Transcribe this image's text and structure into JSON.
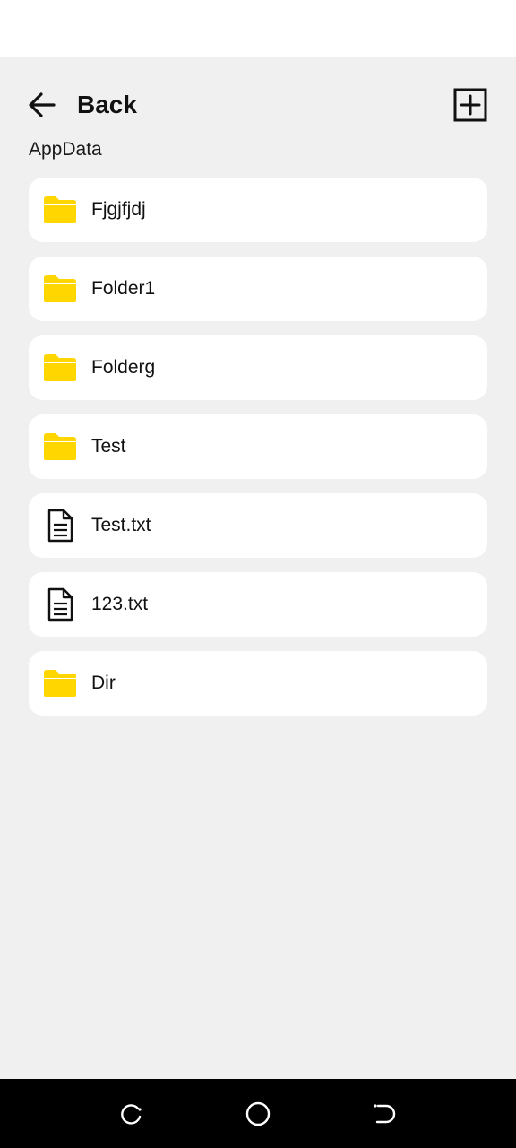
{
  "header": {
    "back_label": "Back",
    "back_icon": "arrow-left-icon",
    "add_icon": "plus-square-icon"
  },
  "path": "AppData",
  "colors": {
    "folder": "#FFD600",
    "background": "#F0F0F0",
    "card": "#FFFFFF",
    "nav_bar": "#000000"
  },
  "items": [
    {
      "name": "Fjgjfjdj",
      "type": "folder",
      "icon": "folder-icon"
    },
    {
      "name": "Folder1",
      "type": "folder",
      "icon": "folder-icon"
    },
    {
      "name": "Folderg",
      "type": "folder",
      "icon": "folder-icon"
    },
    {
      "name": "Test",
      "type": "folder",
      "icon": "folder-icon"
    },
    {
      "name": "Test.txt",
      "type": "file",
      "icon": "document-icon"
    },
    {
      "name": "123.txt",
      "type": "file",
      "icon": "document-icon"
    },
    {
      "name": "Dir",
      "type": "folder",
      "icon": "folder-icon"
    }
  ],
  "nav": {
    "recents_icon": "recent-apps-icon",
    "home_icon": "home-circle-icon",
    "back_icon": "system-back-icon"
  }
}
